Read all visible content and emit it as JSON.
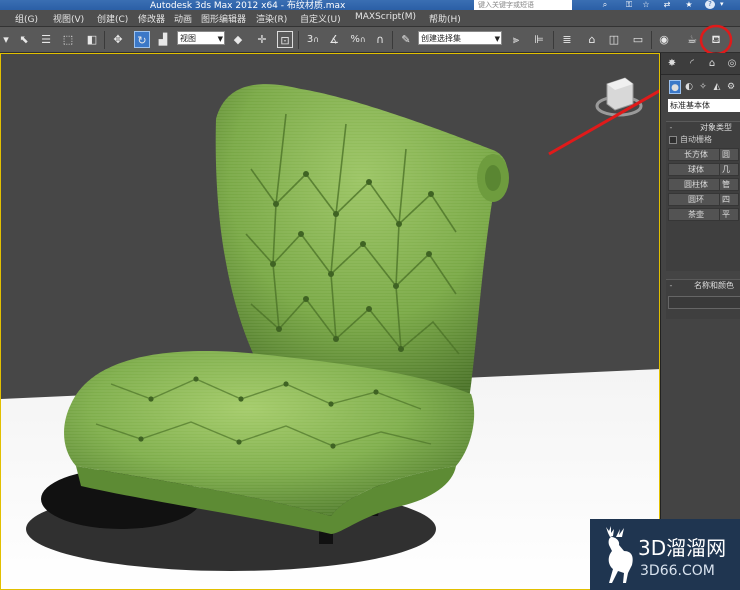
{
  "titlebar": {
    "title": "Autodesk 3ds Max  2012 x64   - 布纹材质.max",
    "search_placeholder": "键入关键字或短语",
    "help_label": "?"
  },
  "menu": {
    "items": [
      "组(G)",
      "视图(V)",
      "创建(C)",
      "修改器",
      "动画",
      "图形编辑器",
      "渲染(R)",
      "自定义(U)",
      "MAXScript(M)",
      "帮助(H)"
    ]
  },
  "toolbar": {
    "reference_coord": "视图",
    "named_selection": "创建选择集",
    "snap_number": "3",
    "percent_label": "%",
    "highlighted_tool": "material-editor-button"
  },
  "command_panel": {
    "category_dropdown": "标准基本体",
    "rollout_object_type": "对象类型",
    "autogrid_label": "自动栅格",
    "object_buttons": [
      "长方体",
      "球体",
      "圆柱体",
      "圆环",
      "茶壶"
    ],
    "object_buttons_right": [
      "圆",
      "几",
      "管",
      "四",
      "平"
    ],
    "rollout_name_color": "名称和颜色"
  },
  "annotation": {
    "color": "#e01a1a",
    "note": "red circle and arrow pointing to material editor button"
  },
  "watermark": {
    "title": "3D溜溜网",
    "site": "3D66.COM"
  },
  "colors": {
    "selection_blue": "#3b78c8",
    "viewport_border": "#e2c000",
    "fabric_green": "#7fae4c"
  }
}
